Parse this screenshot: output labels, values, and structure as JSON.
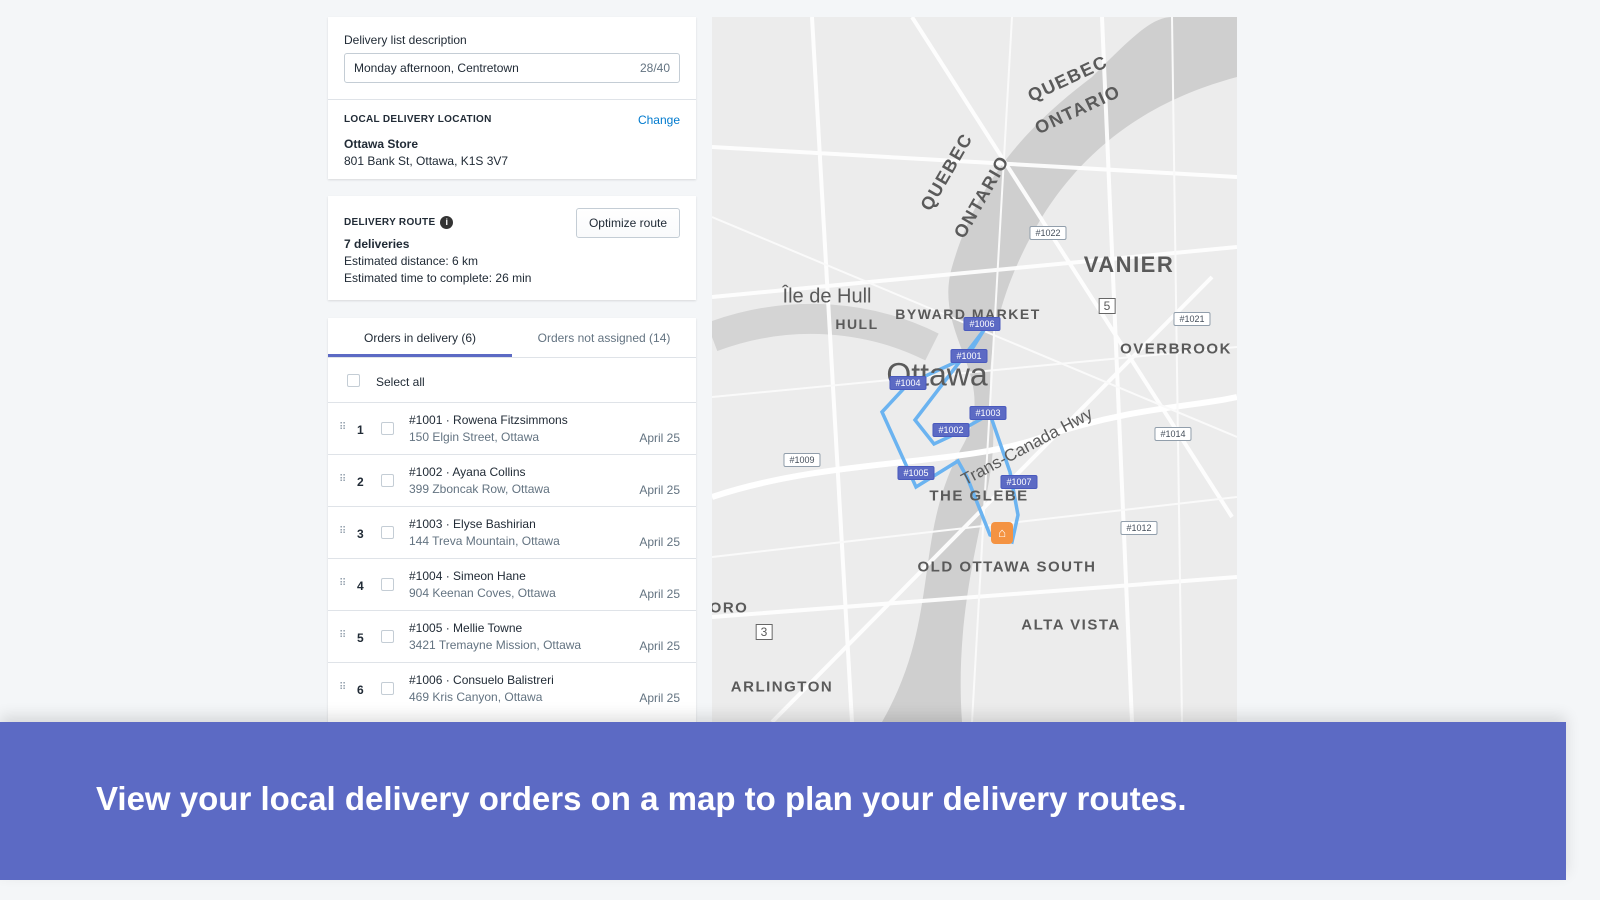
{
  "description": {
    "label": "Delivery list description",
    "value": "Monday afternoon, Centretown",
    "counter": "28/40"
  },
  "location": {
    "heading": "LOCAL DELIVERY LOCATION",
    "change": "Change",
    "store": "Ottawa Store",
    "address": "801 Bank St, Ottawa, K1S 3V7"
  },
  "route": {
    "heading": "DELIVERY ROUTE",
    "info_icon": "info-icon",
    "optimize": "Optimize route",
    "deliveries": "7 deliveries",
    "distance": "Estimated distance: 6 km",
    "time": "Estimated time to complete: 26 min"
  },
  "tabs": [
    {
      "label": "Orders in delivery (6)",
      "active": true
    },
    {
      "label": "Orders not assigned (14)",
      "active": false
    }
  ],
  "select_all": "Select all",
  "orders": [
    {
      "n": "1",
      "title": "#1001 · Rowena Fitzsimmons",
      "address": "150 Elgin Street, Ottawa",
      "date": "April 25"
    },
    {
      "n": "2",
      "title": "#1002 · Ayana Collins",
      "address": "399 Zboncak Row, Ottawa",
      "date": "April 25"
    },
    {
      "n": "3",
      "title": "#1003 · Elyse Bashirian",
      "address": "144 Treva Mountain, Ottawa",
      "date": "April 25"
    },
    {
      "n": "4",
      "title": "#1004 · Simeon Hane",
      "address": "904 Keenan Coves, Ottawa",
      "date": "April 25"
    },
    {
      "n": "5",
      "title": "#1005 · Mellie Towne",
      "address": "3421 Tremayne Mission, Ottawa",
      "date": "April 25"
    },
    {
      "n": "6",
      "title": "#1006 · Consuelo Balistreri",
      "address": "469 Kris Canyon, Ottawa",
      "date": "April 25"
    }
  ],
  "map": {
    "places": [
      "QUEBEC",
      "ONTARIO",
      "QUEBEC",
      "ONTARIO",
      "VANIER",
      "Île de Hull",
      "HULL",
      "BYWARD MARKET",
      "Ottawa",
      "OVERBROOK",
      "Trans-Canada Hwy",
      "THE GLEBE",
      "OLD OTTAWA SOUTH",
      "ALTA VISTA",
      "ORO",
      "ARLINGTON",
      "5",
      "3"
    ],
    "assigned": [
      "#1006",
      "#1001",
      "#1004",
      "#1003",
      "#1002",
      "#1005",
      "#1007"
    ],
    "unassigned": [
      "#1022",
      "#1021",
      "#1014",
      "#1009",
      "#1012"
    ],
    "route_color": "#6bb3f0",
    "store_icon": "store-icon"
  },
  "banner": "View your local delivery orders on a map to plan your delivery routes."
}
